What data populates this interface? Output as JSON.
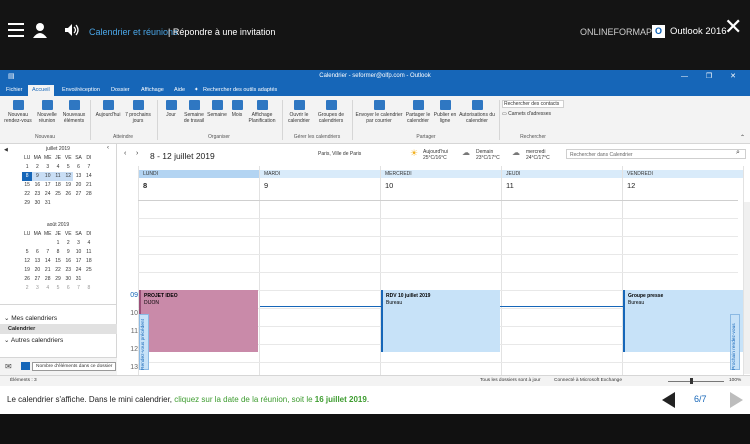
{
  "player": {
    "crumb_course": "Calendrier et réunions",
    "crumb_lesson": "| Répondre à une invitation",
    "brand": "ONLINEFORMAPRO",
    "badge": "O",
    "product": "Outlook 2016",
    "close": "✕"
  },
  "window": {
    "title": "Calendrier - seformer@olfp.com - Outlook",
    "controls": "— ❐ ✕"
  },
  "tabs": [
    "Fichier",
    "Accueil",
    "Envoi/réception",
    "Dossier",
    "Affichage",
    "Aide"
  ],
  "tell_me": "Rechercher des outils adaptés",
  "ribbon": {
    "nouveau": [
      "Nouveau rendez-vous",
      "Nouvelle réunion",
      "Nouveaux éléments"
    ],
    "atteindre": [
      "Aujourd'hui",
      "7 prochains jours"
    ],
    "organiser": [
      "Jour",
      "Semaine de travail",
      "Semaine",
      "Mois",
      "Affichage Planification"
    ],
    "gerer": [
      "Ouvrir le calendrier",
      "Groupes de calendriers"
    ],
    "partager": [
      "Envoyer le calendrier par courrier",
      "Partager le calendrier",
      "Publier en ligne",
      "Autorisations du calendrier"
    ],
    "search_contacts": "Rechercher des contacts",
    "address_book": "Carnets d'adresses",
    "groups": [
      "Nouveau",
      "Atteindre",
      "Organiser",
      "Gérer les calendriers",
      "Partager",
      "Rechercher"
    ]
  },
  "mini_july": {
    "title": "juillet 2019",
    "head": [
      "LU",
      "MA",
      "ME",
      "JE",
      "VE",
      "SA",
      "DI"
    ],
    "weeks": [
      [
        "1",
        "2",
        "3",
        "4",
        "5",
        "6",
        "7"
      ],
      [
        "8",
        "9",
        "10",
        "11",
        "12",
        "13",
        "14"
      ],
      [
        "15",
        "16",
        "17",
        "18",
        "19",
        "20",
        "21"
      ],
      [
        "22",
        "23",
        "24",
        "25",
        "26",
        "27",
        "28"
      ],
      [
        "29",
        "30",
        "31",
        "",
        "",
        "",
        ""
      ]
    ]
  },
  "mini_aug": {
    "title": "août 2019",
    "head": [
      "LU",
      "MA",
      "ME",
      "JE",
      "VE",
      "SA",
      "DI"
    ],
    "weeks": [
      [
        "",
        "",
        "",
        "1",
        "2",
        "3",
        "4"
      ],
      [
        "5",
        "6",
        "7",
        "8",
        "9",
        "10",
        "11"
      ],
      [
        "12",
        "13",
        "14",
        "15",
        "16",
        "17",
        "18"
      ],
      [
        "19",
        "20",
        "21",
        "22",
        "23",
        "24",
        "25"
      ],
      [
        "26",
        "27",
        "28",
        "29",
        "30",
        "31",
        ""
      ],
      [
        "2",
        "3",
        "4",
        "5",
        "6",
        "7",
        "8"
      ]
    ]
  },
  "nav": {
    "mes_calendriers": "Mes calendriers",
    "calendrier": "Calendrier",
    "autres": "Autres calendriers",
    "tooltip": "Nombre d'éléments dans ce dossier"
  },
  "calendar": {
    "range": "8 - 12 juillet 2019",
    "location": "Paris, Ville de Paris",
    "weather": [
      {
        "day": "Aujourd'hui",
        "temp": "25°C/16°C"
      },
      {
        "day": "Demain",
        "temp": "23°C/17°C"
      },
      {
        "day": "mercredi",
        "temp": "24°C/17°C"
      }
    ],
    "search_placeholder": "Rechercher dans Calendrier",
    "days": [
      {
        "name": "LUNDI",
        "num": "8"
      },
      {
        "name": "MARDI",
        "num": "9"
      },
      {
        "name": "MERCREDI",
        "num": "10"
      },
      {
        "name": "JEUDI",
        "num": "11"
      },
      {
        "name": "VENDREDI",
        "num": "12"
      }
    ],
    "hours": [
      "09",
      "10",
      "11",
      "12",
      "13",
      "14",
      "15",
      "16"
    ],
    "prev_label": "Rendez-vous précédent",
    "next_label": "Prochain rendez-vous",
    "events": [
      {
        "title": "PROJET IDEO",
        "place": "DIJON"
      },
      {
        "title": "RDV 10 juillet 2019",
        "place": "Bureau"
      },
      {
        "title": "Groupe presse",
        "place": "Bureau"
      }
    ]
  },
  "status": {
    "elements": "Éléments : 3",
    "sync": "Tous les dossiers sont à jour",
    "conn": "Connecté à Microsoft Exchange",
    "zoom": "100%"
  },
  "caption": {
    "text1": "Le calendrier s'affiche. Dans le mini calendrier, ",
    "text2": "cliquez sur la date de la réunion, soit le ",
    "text3": "16 juillet 2019",
    "text4": "."
  },
  "pager": {
    "current": "6",
    "total": "/7"
  },
  "colors": {
    "accent": "#1666b8",
    "event_pink": "#c98aa9",
    "event_blue": "#c7e2f8"
  }
}
